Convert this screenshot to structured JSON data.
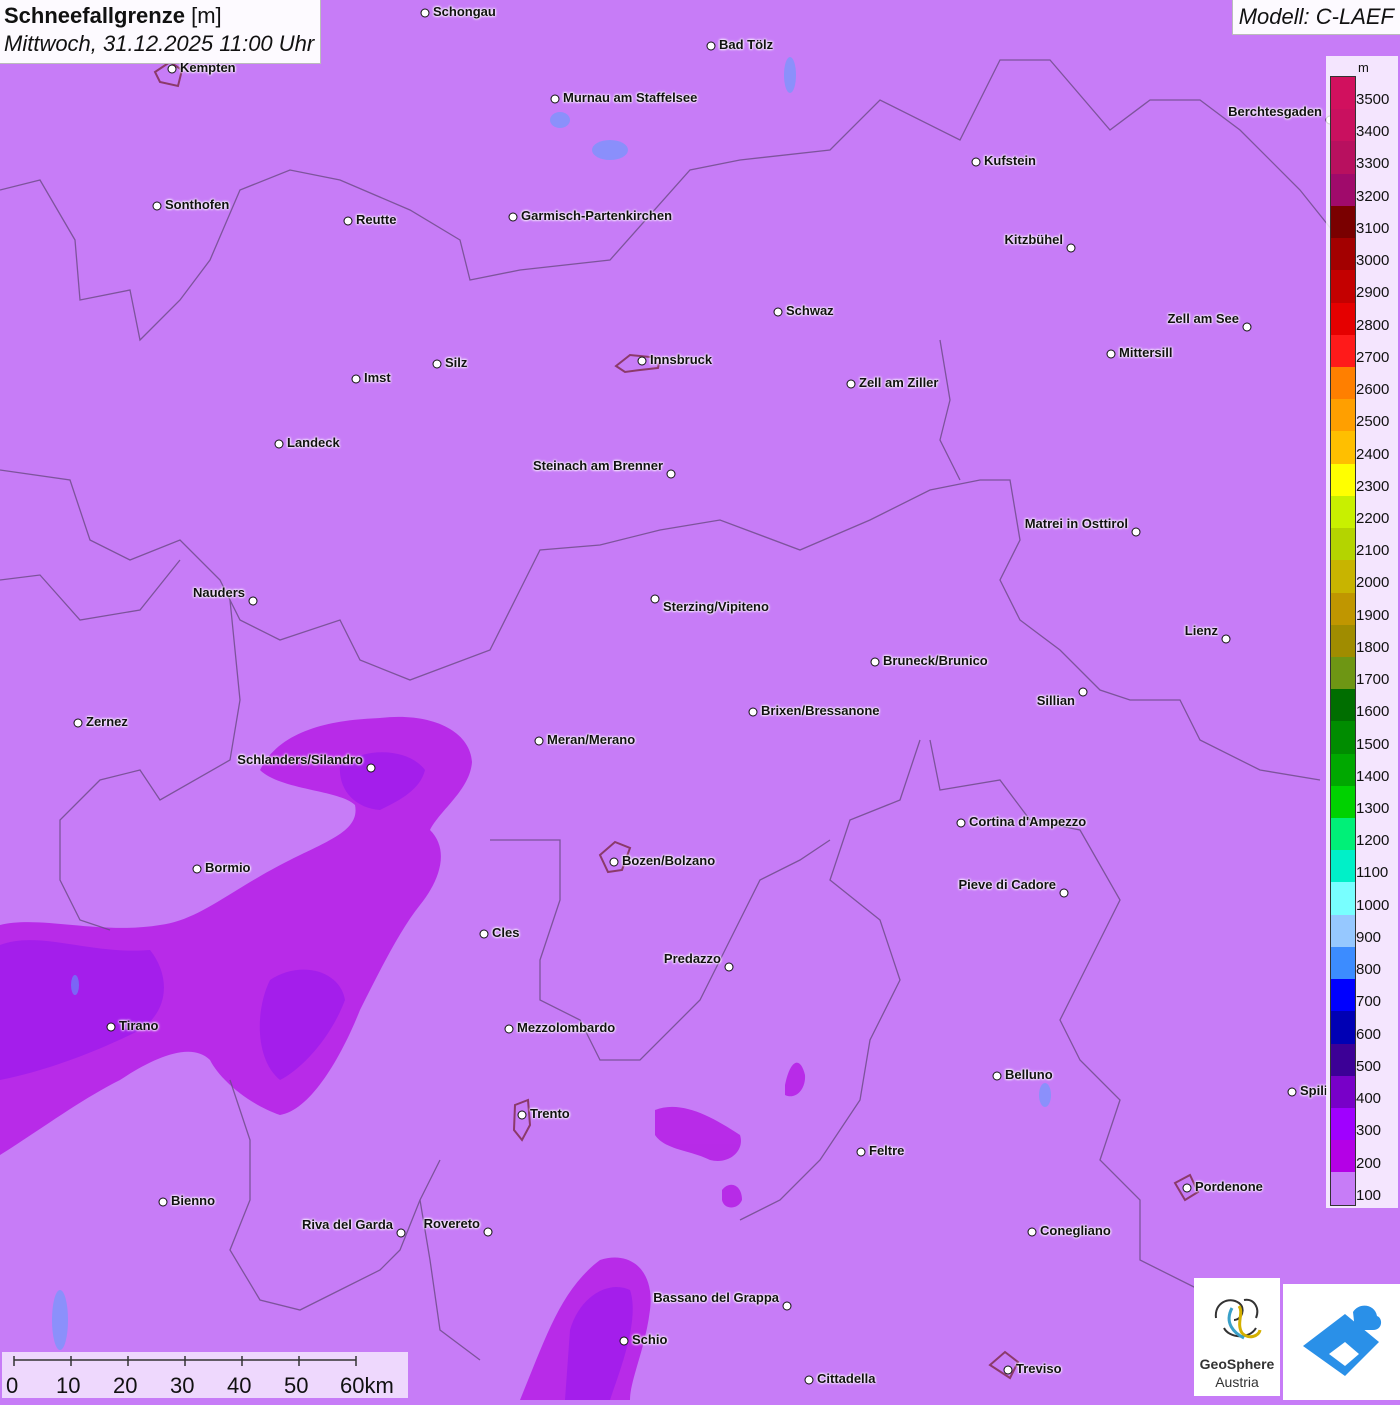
{
  "title": {
    "main": "Schneefallgrenze",
    "unit": "[m]",
    "datetime": "Mittwoch, 31.12.2025 11:00 Uhr"
  },
  "model_label": "Modell: C-LAEF",
  "legend": {
    "unit": "m",
    "labels": [
      "3500",
      "3400",
      "3300",
      "3200",
      "3100",
      "3000",
      "2900",
      "2800",
      "2700",
      "2600",
      "2500",
      "2400",
      "2300",
      "2200",
      "2100",
      "2000",
      "1900",
      "1800",
      "1700",
      "1600",
      "1500",
      "1400",
      "1300",
      "1200",
      "1100",
      "1000",
      "900",
      "800",
      "700",
      "600",
      "500",
      "400",
      "300",
      "200",
      "100"
    ],
    "colors": [
      "#d1105e",
      "#c9105f",
      "#b8105f",
      "#a00a6b",
      "#7a0000",
      "#a30000",
      "#c40000",
      "#e50000",
      "#ff1a1a",
      "#ff7f00",
      "#ff9f00",
      "#ffbf00",
      "#ffff00",
      "#c8f000",
      "#b4d400",
      "#c8b400",
      "#c09600",
      "#a08c00",
      "#6e9614",
      "#006e00",
      "#008c00",
      "#00a800",
      "#00d200",
      "#00f078",
      "#00f0c8",
      "#78ffff",
      "#96c8ff",
      "#3c8cff",
      "#0000ff",
      "#0000b4",
      "#3c0096",
      "#7800c8",
      "#a000ff",
      "#b400e6",
      "#c77cf7"
    ]
  },
  "cities": [
    {
      "name": "Schongau"
    },
    {
      "name": "Bad Tölz"
    },
    {
      "name": "Kempten"
    },
    {
      "name": "Murnau am Staffelsee"
    },
    {
      "name": "Berchtesgaden"
    },
    {
      "name": "Kufstein"
    },
    {
      "name": "Sonthofen"
    },
    {
      "name": "Reutte"
    },
    {
      "name": "Garmisch-Partenkirchen"
    },
    {
      "name": "Kitzbühel"
    },
    {
      "name": "Schwaz"
    },
    {
      "name": "Zell am See"
    },
    {
      "name": "Mittersill"
    },
    {
      "name": "Innsbruck"
    },
    {
      "name": "Silz"
    },
    {
      "name": "Imst"
    },
    {
      "name": "Zell am Ziller"
    },
    {
      "name": "Landeck"
    },
    {
      "name": "Steinach am Brenner"
    },
    {
      "name": "Matrei in Osttirol"
    },
    {
      "name": "Nauders"
    },
    {
      "name": "Sterzing/Vipiteno"
    },
    {
      "name": "Lienz"
    },
    {
      "name": "Bruneck/Brunico"
    },
    {
      "name": "Sillian"
    },
    {
      "name": "Zernez"
    },
    {
      "name": "Brixen/Bressanone"
    },
    {
      "name": "Meran/Merano"
    },
    {
      "name": "Schlanders/Silandro"
    },
    {
      "name": "Cortina d'Ampezzo"
    },
    {
      "name": "Bozen/Bolzano"
    },
    {
      "name": "Bormio"
    },
    {
      "name": "Pieve di Cadore"
    },
    {
      "name": "Cles"
    },
    {
      "name": "Predazzo"
    },
    {
      "name": "Tirano"
    },
    {
      "name": "Mezzolombardo"
    },
    {
      "name": "Belluno"
    },
    {
      "name": "Spili"
    },
    {
      "name": "Trento"
    },
    {
      "name": "Feltre"
    },
    {
      "name": "Pordenone"
    },
    {
      "name": "Bienno"
    },
    {
      "name": "Riva del Garda"
    },
    {
      "name": "Rovereto"
    },
    {
      "name": "Conegliano"
    },
    {
      "name": "Bassano del Grappa"
    },
    {
      "name": "Schio"
    },
    {
      "name": "Treviso"
    },
    {
      "name": "Cittadella"
    }
  ],
  "scale_bar": {
    "labels": [
      "0",
      "10",
      "20",
      "30",
      "40",
      "50",
      "60km"
    ]
  },
  "logo": {
    "line1": "GeoSphere",
    "line2": "Austria"
  },
  "colors": {
    "background": "#c77cf7",
    "level_200": "#b400e6",
    "level_300": "#a000ff"
  }
}
